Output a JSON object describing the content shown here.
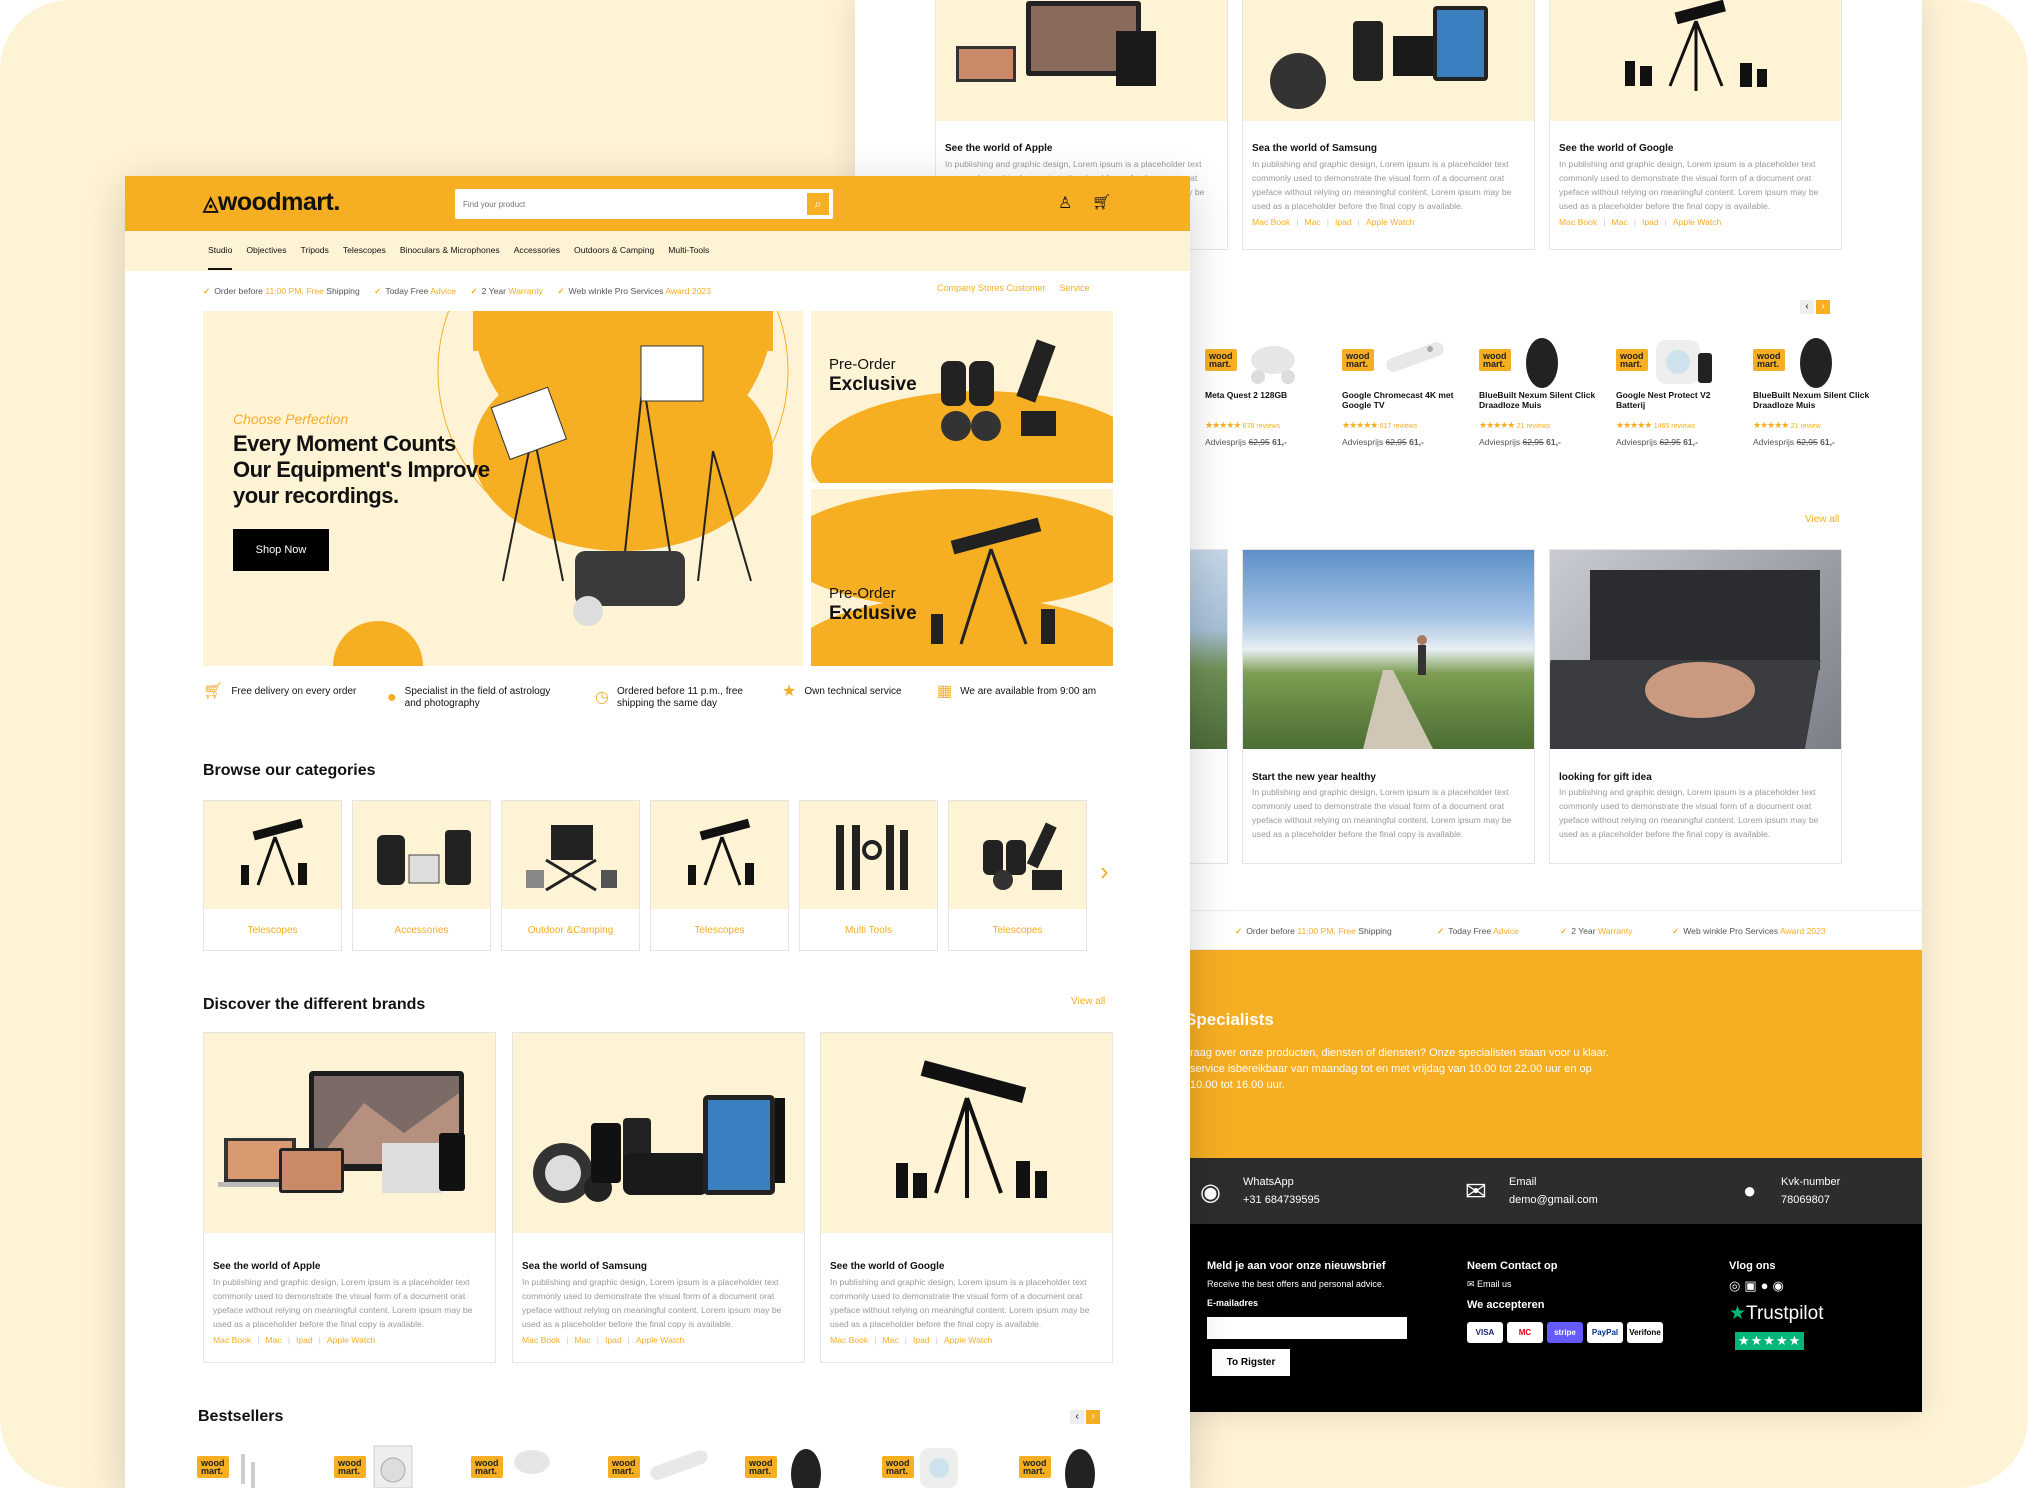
{
  "brand": {
    "name": "woodmart."
  },
  "search": {
    "placeholder": "Find your product"
  },
  "nav": [
    "Studio",
    "Objectives",
    "Tripods",
    "Telescopes",
    "Binoculars & Microphones",
    "Accessories",
    "Outdoors & Camping",
    "Multi-Tools"
  ],
  "usp": {
    "u1": {
      "a": "Order before ",
      "b": "11:00 PM, Free",
      "c": " Shipping"
    },
    "u2": {
      "a": "Today Free ",
      "b": "Advice"
    },
    "u3": {
      "a": "2 Year ",
      "b": "Warranty"
    },
    "u4": {
      "a": "Web winkle Pro Services ",
      "b": "Award 2023"
    },
    "links": [
      "Company Stores Customer",
      "Service"
    ]
  },
  "hero": {
    "kicker": "Choose Perfection",
    "line1": "Every Moment Counts",
    "line2": "Our Equipment's Improve",
    "line3": "your recordings.",
    "cta": "Shop Now"
  },
  "promo": [
    {
      "l1": "Pre-Order",
      "l2": "Exclusive"
    },
    {
      "l1": "Pre-Order",
      "l2": "Exclusive"
    }
  ],
  "features": [
    "Free delivery on every order",
    "Specialist in the field of astrology and photography",
    "Ordered before 11 p.m., free shipping the same day",
    "Own technical service",
    "We are available from 9:00 am"
  ],
  "categories": {
    "title": "Browse our categories",
    "items": [
      "Telescopes",
      "Accessories",
      "Outdoor &Camping",
      "Telescopes",
      "Multi Tools",
      "Telescopes"
    ]
  },
  "brands": {
    "title": "Discover the different brands",
    "view_all": "View all",
    "desc": "In publishing and graphic design, Lorem ipsum is a placeholder text commonly used to demonstrate the visual form of a document orat ypeface without relying on meaningful content. Lorem ipsum may be used as a placeholder before the final copy is available.",
    "items": [
      {
        "title": "See the world of Apple"
      },
      {
        "title": "Sea the world of Samsung"
      },
      {
        "title": "See the world of Google"
      }
    ],
    "tags": [
      "Mac Book",
      "Mac",
      "Ipad",
      "Apple Watch"
    ]
  },
  "bestsellers": {
    "title": "Bestsellers"
  },
  "products": [
    {
      "name": "Meta Quest 2 128GB",
      "reviews": "678 reviews"
    },
    {
      "name": "Google Chromecast 4K met Google TV",
      "reviews": "617 reviews"
    },
    {
      "name": "BlueBuilt Nexum Silent Click Draadloze Muis",
      "reviews": "21 reviews"
    },
    {
      "name": "Google Nest Protect V2 Batterij",
      "reviews": "1465 reviews"
    },
    {
      "name": "BlueBuilt Nexum Silent Click Draadloze Muis",
      "reviews": "21 review"
    }
  ],
  "price": {
    "label": "Adviesprijs",
    "old": "62,95",
    "new": "61,-"
  },
  "blog": {
    "view_all": "View all",
    "items": [
      {
        "title": "Start the new year healthy"
      },
      {
        "title": "looking for gift idea"
      }
    ]
  },
  "specialists": {
    "title": "Specialists",
    "l1": "raag over onze producten, diensten of diensten? Onze specialisten staan voor u klaar.",
    "l2": "service isbereikbaar van maandag tot en met vrijdag van 10.00 tot 22.00 uur en op",
    "l3": "10.00 tot 16.00 uur."
  },
  "contact": [
    {
      "label": "WhatsApp",
      "value": "+31 684739595"
    },
    {
      "label": "Email",
      "value": "demo@gmail.com"
    },
    {
      "label": "Kvk-number",
      "value": "78069807"
    }
  ],
  "footer": {
    "newsletter_title": "Meld je aan voor onze nieuwsbrief",
    "newsletter_sub": "Receive the best offers and personal advice.",
    "email_label": "E-mailadres",
    "register": "To Rigster",
    "contact_title": "Neem Contact op",
    "email_us": "Email us",
    "accept_title": "We accepteren",
    "vlog": "Vlog ons",
    "trustpilot": "Trustpilot",
    "payments": [
      "VISA",
      "MC",
      "stripe",
      "PayPal",
      "Verifone"
    ]
  },
  "colors": {
    "accent": "#f6ae23",
    "cream": "#fff3d6",
    "dark": "#2d2d2d",
    "black": "#000000"
  },
  "logo_badge": "wood mart."
}
